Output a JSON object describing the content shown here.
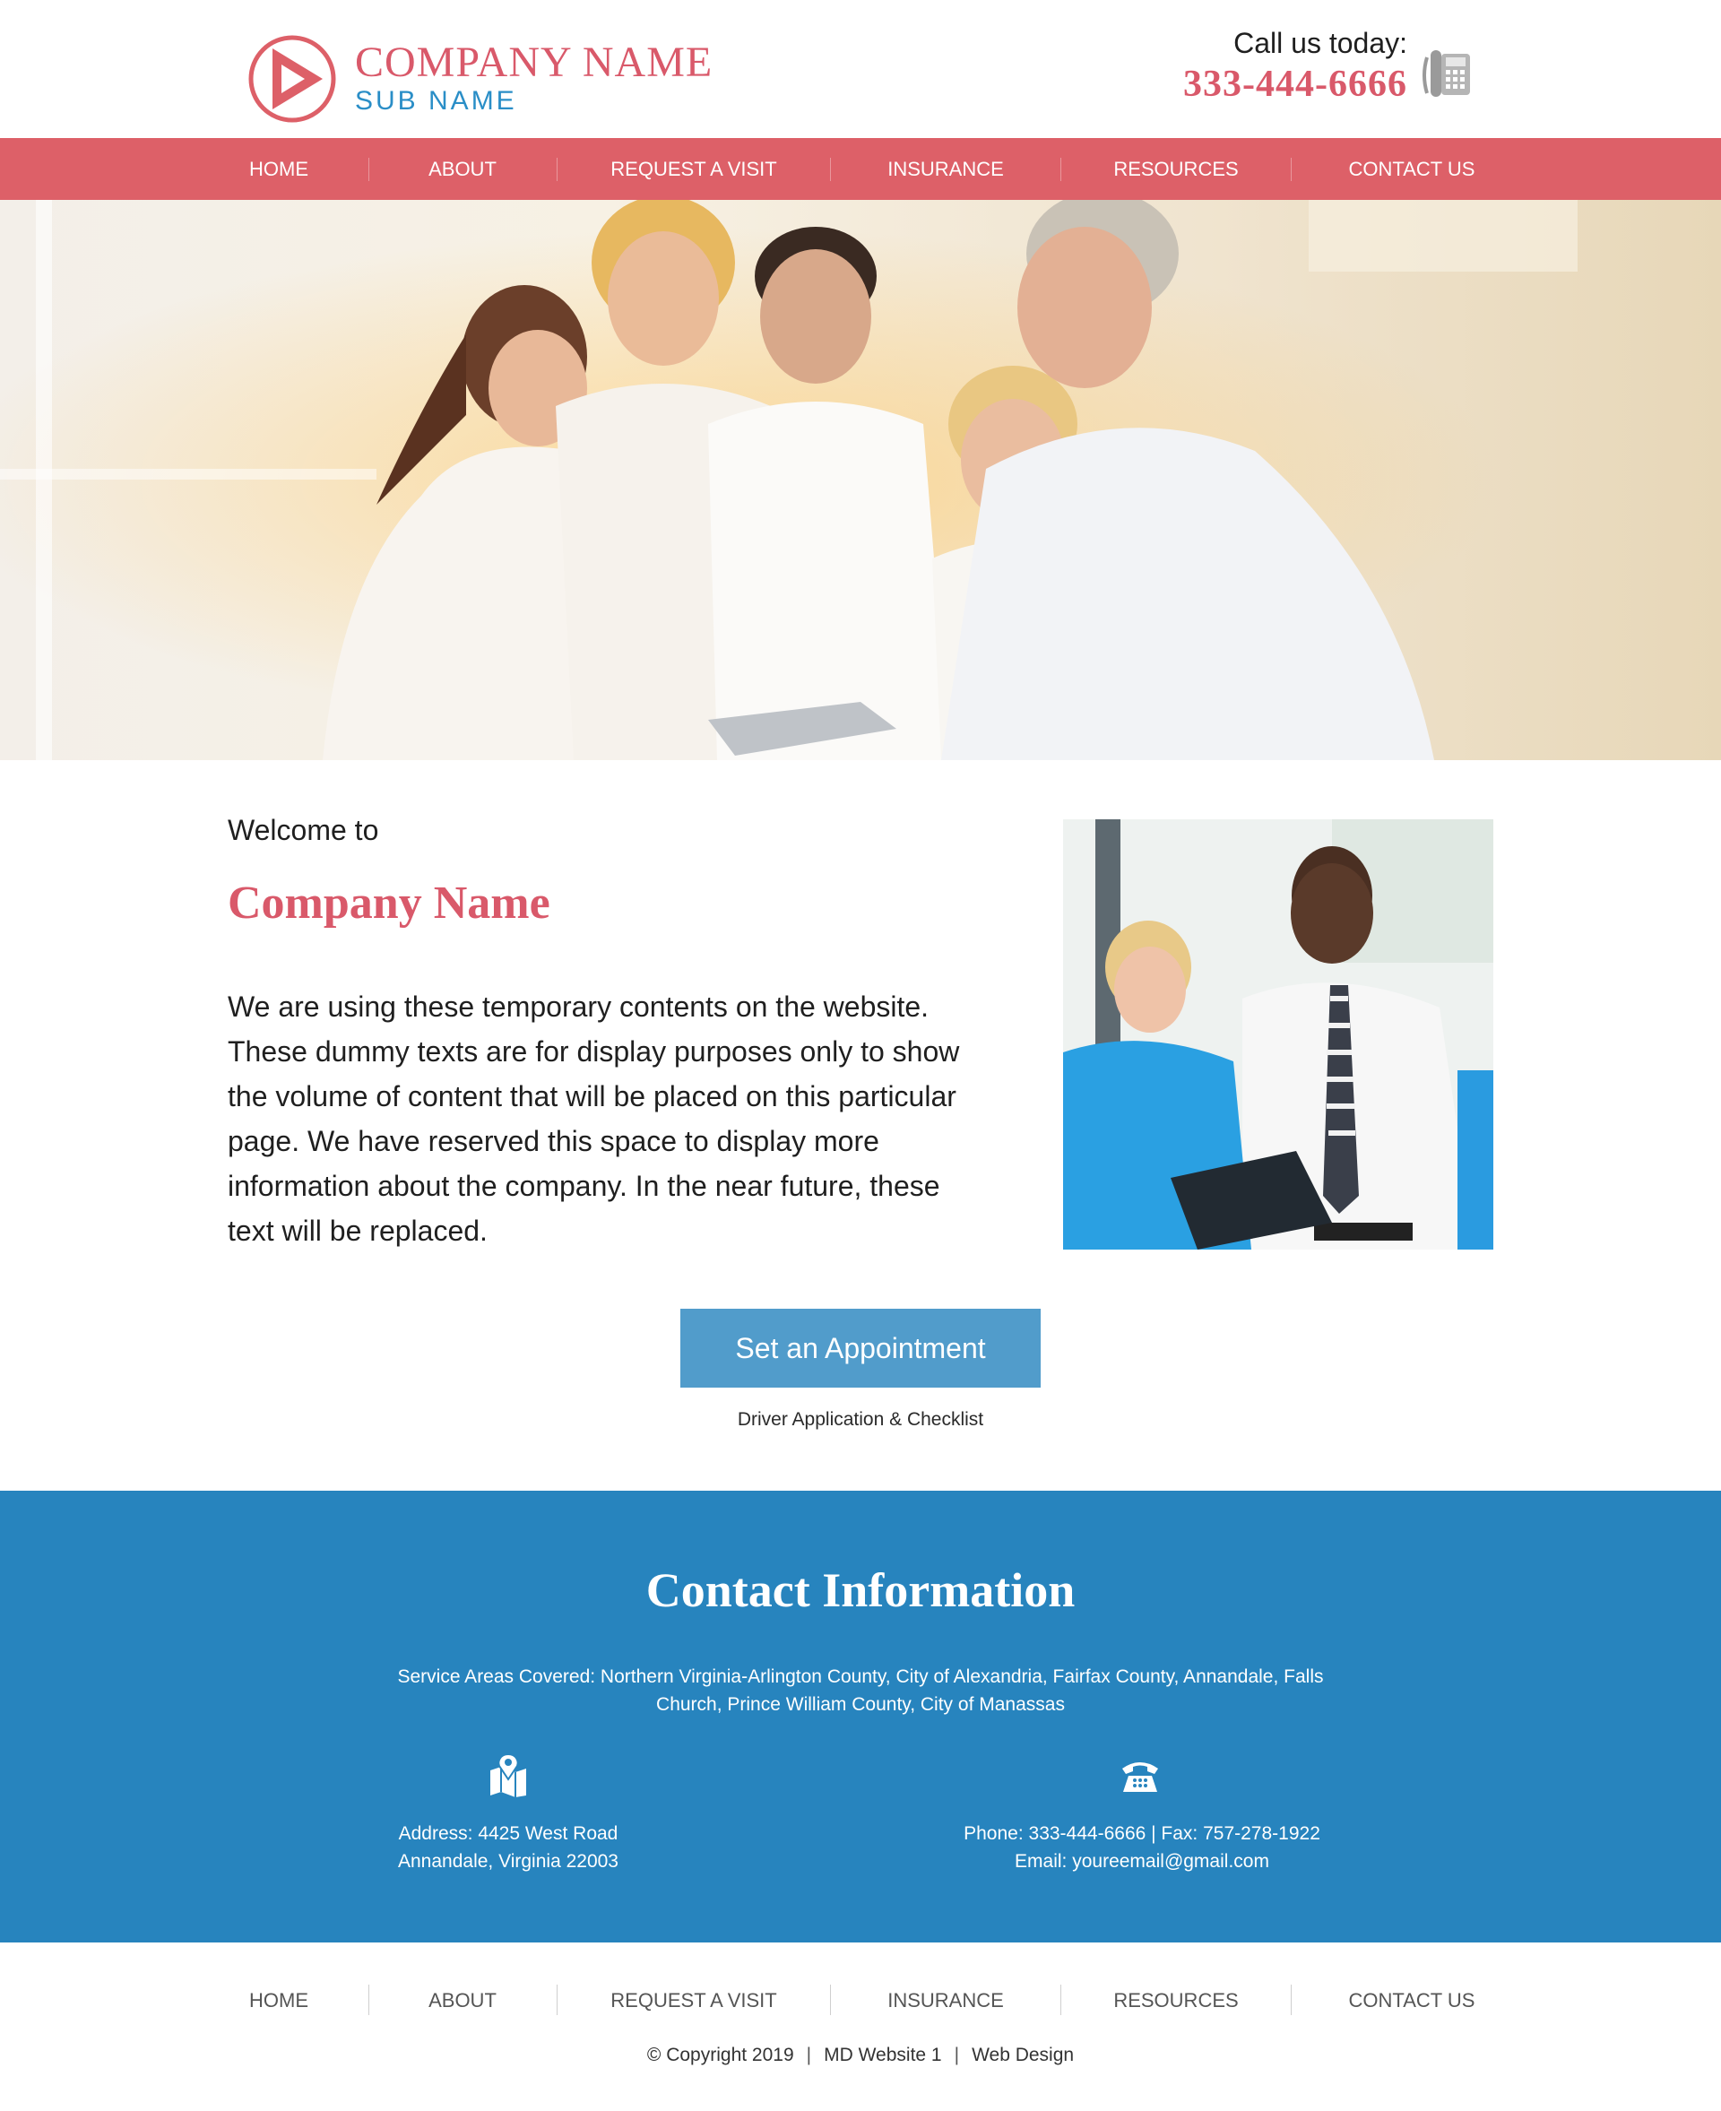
{
  "header": {
    "company_name": "COMPANY NAME",
    "sub_name": "SUB NAME",
    "call_label": "Call us today:",
    "phone": "333-444-6666"
  },
  "nav": {
    "items": [
      "HOME",
      "ABOUT",
      "REQUEST A VISIT",
      "INSURANCE",
      "RESOURCES",
      "CONTACT US"
    ]
  },
  "welcome": {
    "small": "Welcome to",
    "title": "Company Name",
    "body": "We are using these temporary contents on the website. These dummy texts are for display purposes only to show the volume of content that will be placed on this particular page. We have reserved this space to display more information about the company. In the near future, these text will be replaced."
  },
  "cta": {
    "label": "Set an Appointment",
    "sub_link": "Driver Application & Checklist"
  },
  "contact": {
    "title": "Contact Information",
    "service_areas": "Service Areas Covered: Northern Virginia-Arlington County, City of Alexandria, Fairfax County, Annandale, Falls Church, Prince William County, City of Manassas",
    "address_line1": "Address: 4425 West Road",
    "address_line2": "Annandale, Virginia 22003",
    "phone_line": "Phone: 333-444-6666 | Fax: 757-278-1922",
    "email_line": "Email: youreemail@gmail.com",
    "icons": [
      "map-icon",
      "telephone-icon"
    ]
  },
  "footer": {
    "nav_items": [
      "HOME",
      "ABOUT",
      "REQUEST A VISIT",
      "INSURANCE",
      "RESOURCES",
      "CONTACT US"
    ],
    "copyright": "© Copyright 2019",
    "site_name": "MD Website 1",
    "credit": "Web Design"
  },
  "colors": {
    "brand_red": "#dd6068",
    "brand_blue": "#2784be",
    "button_blue": "#519ccb"
  }
}
